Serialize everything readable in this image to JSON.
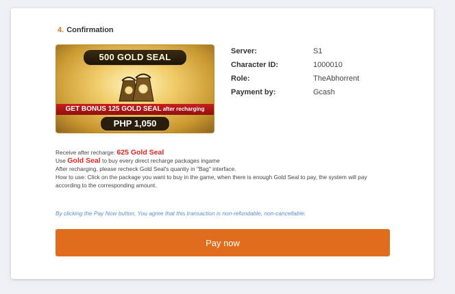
{
  "confirmation": {
    "step_number": "4.",
    "step_title": "Confirmation"
  },
  "package_banner": {
    "title": "500 GOLD SEAL",
    "bonus_text": "GET BONUS 125 GOLD SEAL",
    "bonus_suffix": "after recharging",
    "price": "PHP 1,050",
    "colors": {
      "ribbon": "#c81e1e",
      "gold": "#d9b25a"
    }
  },
  "order_info": [
    {
      "label": "Server:",
      "value": "S1"
    },
    {
      "label": "Character ID:",
      "value": "1000010"
    },
    {
      "label": "Role:",
      "value": "TheAbhorrent"
    },
    {
      "label": "Payment by:",
      "value": "Gcash"
    }
  ],
  "notes": {
    "receive_prefix": "Receive after recharge:",
    "receive_amount": "625 Gold Seal",
    "use_prefix": "Use",
    "use_highlight": "Gold Seal",
    "use_suffix": "to buy every direct recharge packages ingame",
    "recheck": "After recharging, please recheck Gold Seal's quantiy in \"Bag\" interface.",
    "how_to_use": "How to use: Click on the package you want to buy in the game, when there is enough Gold Seal to pay, the system will pay according to the corresponding amount."
  },
  "disclaimer": "By clicking the Pay Now button, You agree that this transaction is non-refundable, non-cancellable.",
  "pay_button": {
    "label": "Pay now",
    "color": "#e06c1e"
  }
}
